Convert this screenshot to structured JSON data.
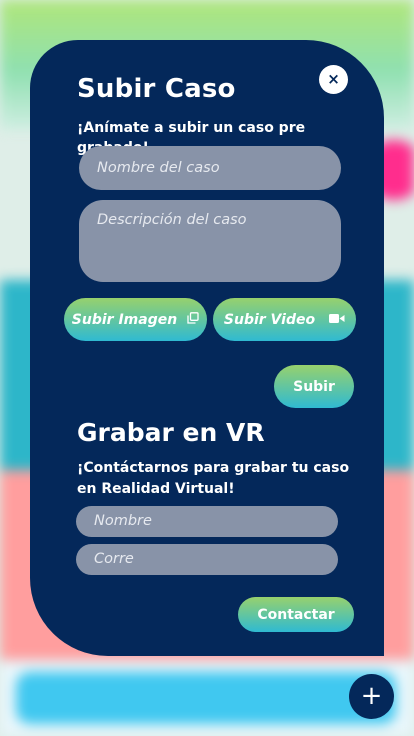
{
  "modal": {
    "title": "Subir Caso",
    "subtitle": "¡Anímate a subir un caso pre grabado!",
    "name_placeholder": "Nombre del caso",
    "description_placeholder": "Descripción del caso",
    "upload_image_label": "Subir Imagen",
    "upload_video_label": "Subir Video",
    "submit_label": "Subir",
    "close_label": "×",
    "vr_title": "Grabar en VR",
    "vr_subtitle": "¡Contáctarnos para grabar tu caso en Realidad Virtual!",
    "contact_name_placeholder": "Nombre",
    "contact_email_placeholder": "Corre",
    "contact_label": "Contactar"
  },
  "fab": {
    "label": "+"
  },
  "icons": {
    "copy": "copy-icon",
    "video": "video-camera-icon",
    "close": "close-icon",
    "plus": "plus-icon"
  },
  "colors": {
    "card": "#04285a",
    "field": "#8893a8",
    "gradient_top": "#97d16d",
    "gradient_bottom": "#2fbad2"
  }
}
